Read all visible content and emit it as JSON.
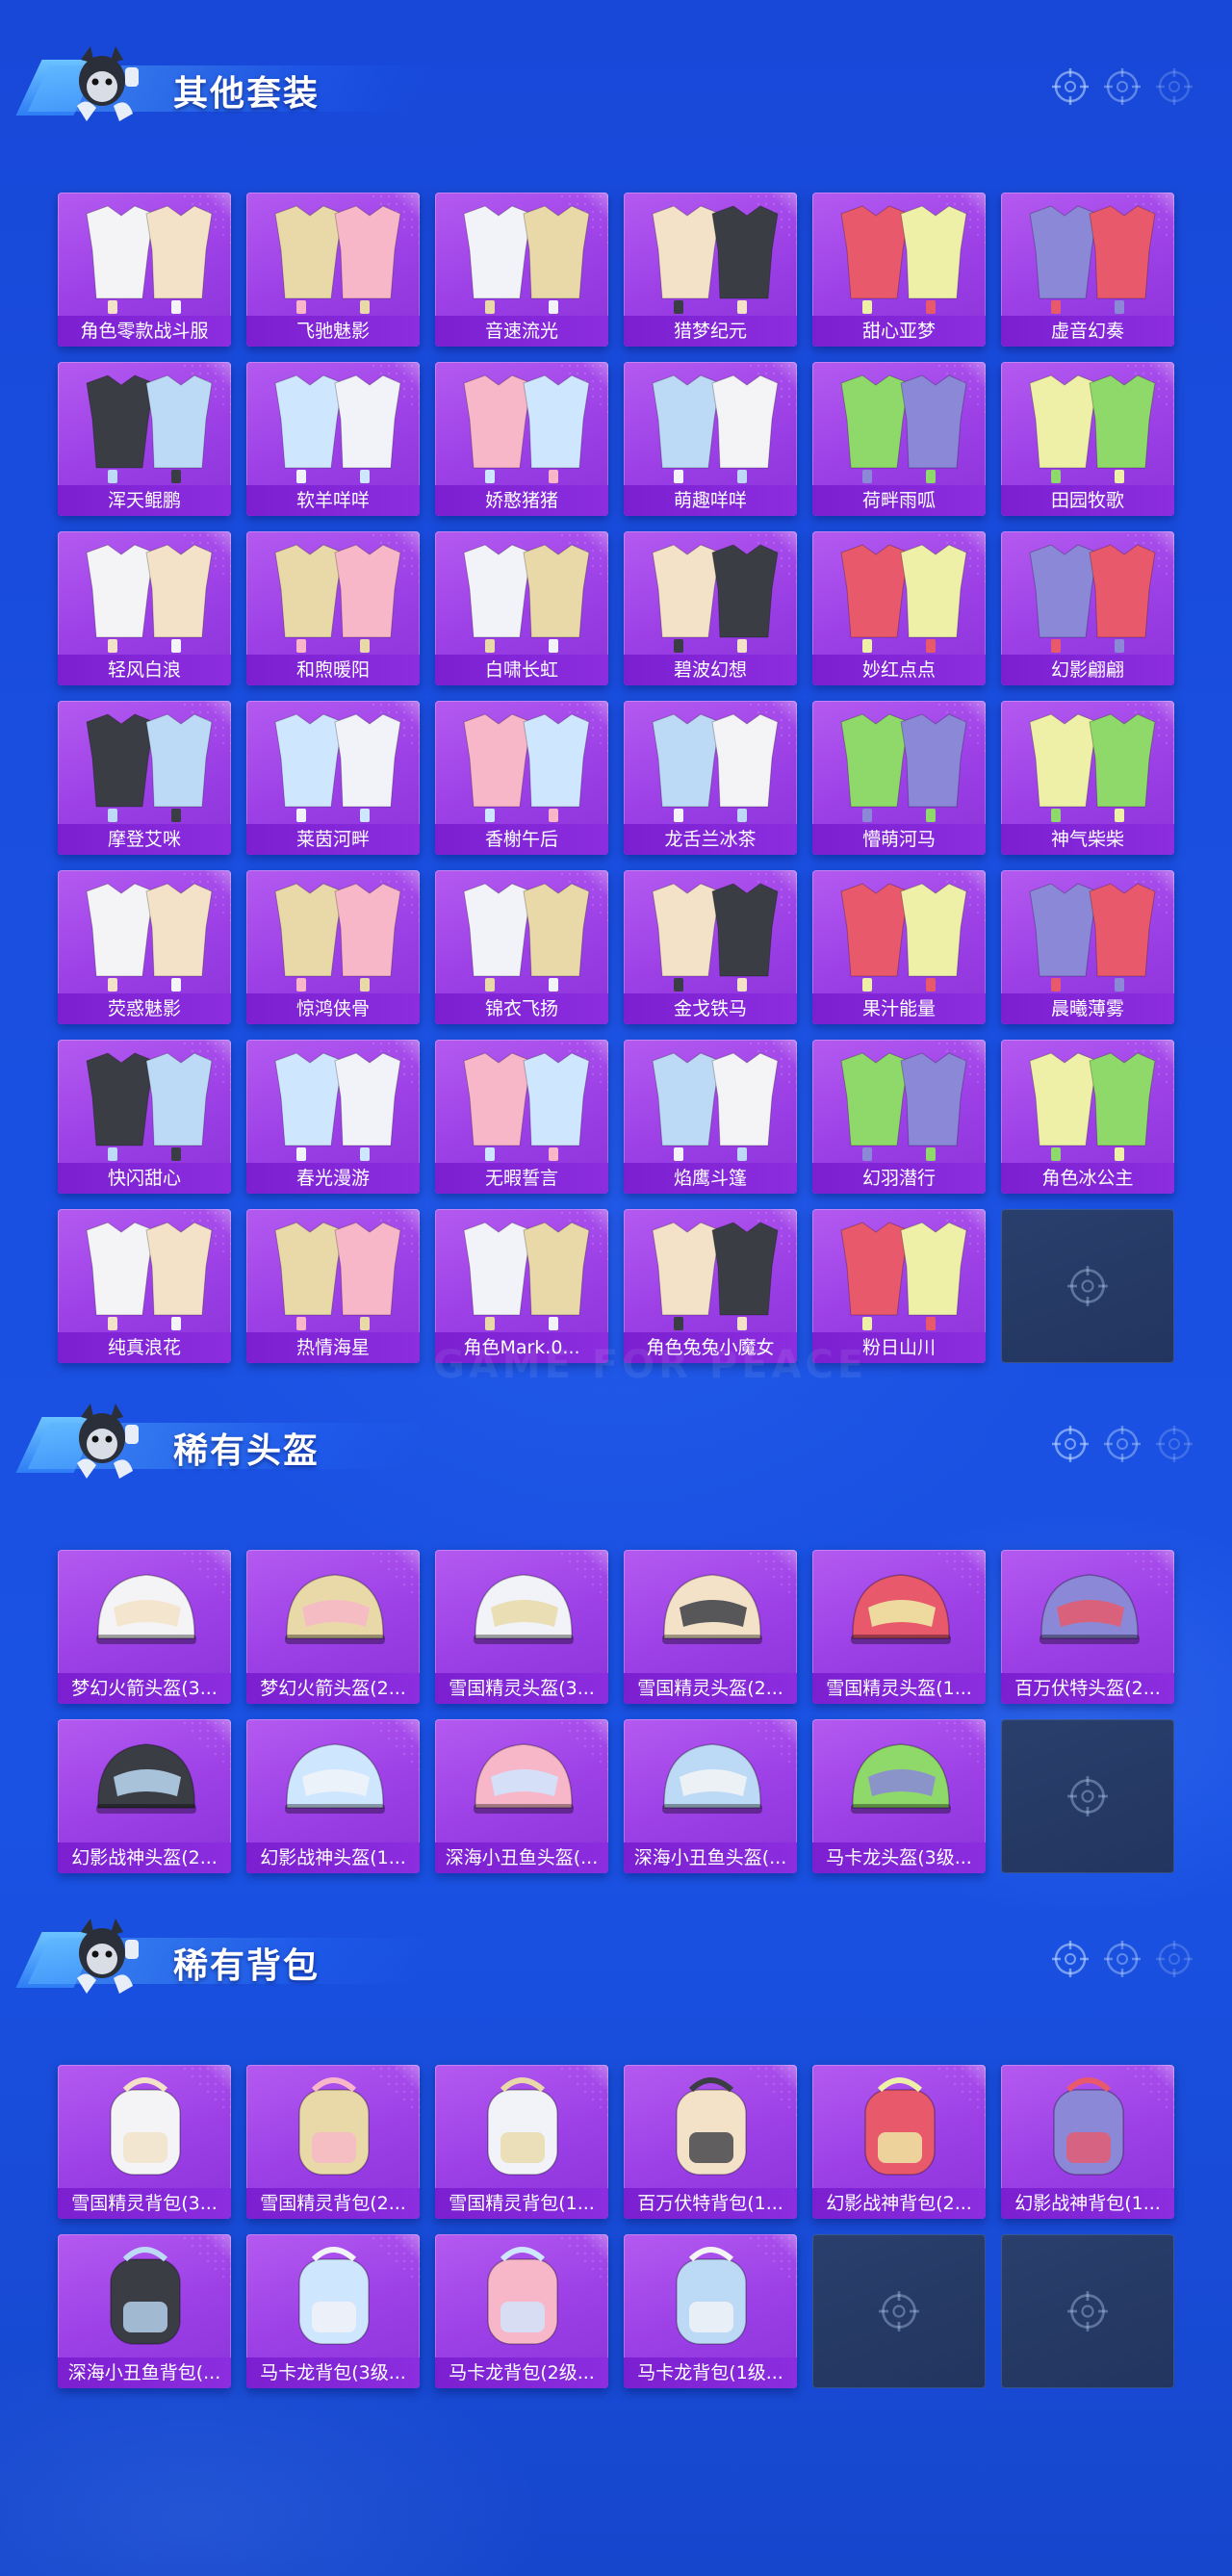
{
  "sections": [
    {
      "title": "其他套装",
      "kind": "outfit",
      "items": [
        "角色零款战斗服",
        "飞驰魅影",
        "音速流光",
        "猎梦纪元",
        "甜心亚梦",
        "虚音幻奏",
        "浑天鲲鹏",
        "软羊咩咩",
        "娇憨猪猪",
        "萌趣咩咩",
        "荷畔雨呱",
        "田园牧歌",
        "轻风白浪",
        "和煦暖阳",
        "白啸长虹",
        "碧波幻想",
        "妙红点点",
        "幻影翩翩",
        "摩登艾咪",
        "莱茵河畔",
        "香榭午后",
        "龙舌兰冰茶",
        "懵萌河马",
        "神气柴柴",
        "荧惑魅影",
        "惊鸿侠骨",
        "锦衣飞扬",
        "金戈铁马",
        "果汁能量",
        "晨曦薄雾",
        "快闪甜心",
        "春光漫游",
        "无暇誓言",
        "焰鹰斗篷",
        "幻羽潜行",
        "角色冰公主",
        "纯真浪花",
        "热情海星",
        "角色Mark.0...",
        "角色兔兔小魔女",
        "粉日山川"
      ],
      "empty_slots": 1
    },
    {
      "title": "稀有头盔",
      "kind": "helmet",
      "items": [
        "梦幻火箭头盔(3...",
        "梦幻火箭头盔(2...",
        "雪国精灵头盔(3...",
        "雪国精灵头盔(2...",
        "雪国精灵头盔(1...",
        "百万伏特头盔(2...",
        "幻影战神头盔(2...",
        "幻影战神头盔(1...",
        "深海小丑鱼头盔(...",
        "深海小丑鱼头盔(...",
        "马卡龙头盔(3级..."
      ],
      "empty_slots": 1
    },
    {
      "title": "稀有背包",
      "kind": "backpack",
      "items": [
        "雪国精灵背包(3...",
        "雪国精灵背包(2...",
        "雪国精灵背包(1...",
        "百万伏特背包(1...",
        "幻影战神背包(2...",
        "幻影战神背包(1...",
        "深海小丑鱼背包(...",
        "马卡龙背包(3级...",
        "马卡龙背包(2级...",
        "马卡龙背包(1级..."
      ],
      "empty_slots": 2
    }
  ],
  "watermark": "GAME FOR PEACE",
  "colors": {
    "background": "#1a4fe0",
    "card": "#a04ae8",
    "card_label": "#7b1fd1",
    "empty_card": "#263a66"
  },
  "icons": {
    "header_right": "crosshair-icon",
    "empty_slot": "crosshair-placeholder-icon",
    "header_left": "mascot-icon"
  }
}
